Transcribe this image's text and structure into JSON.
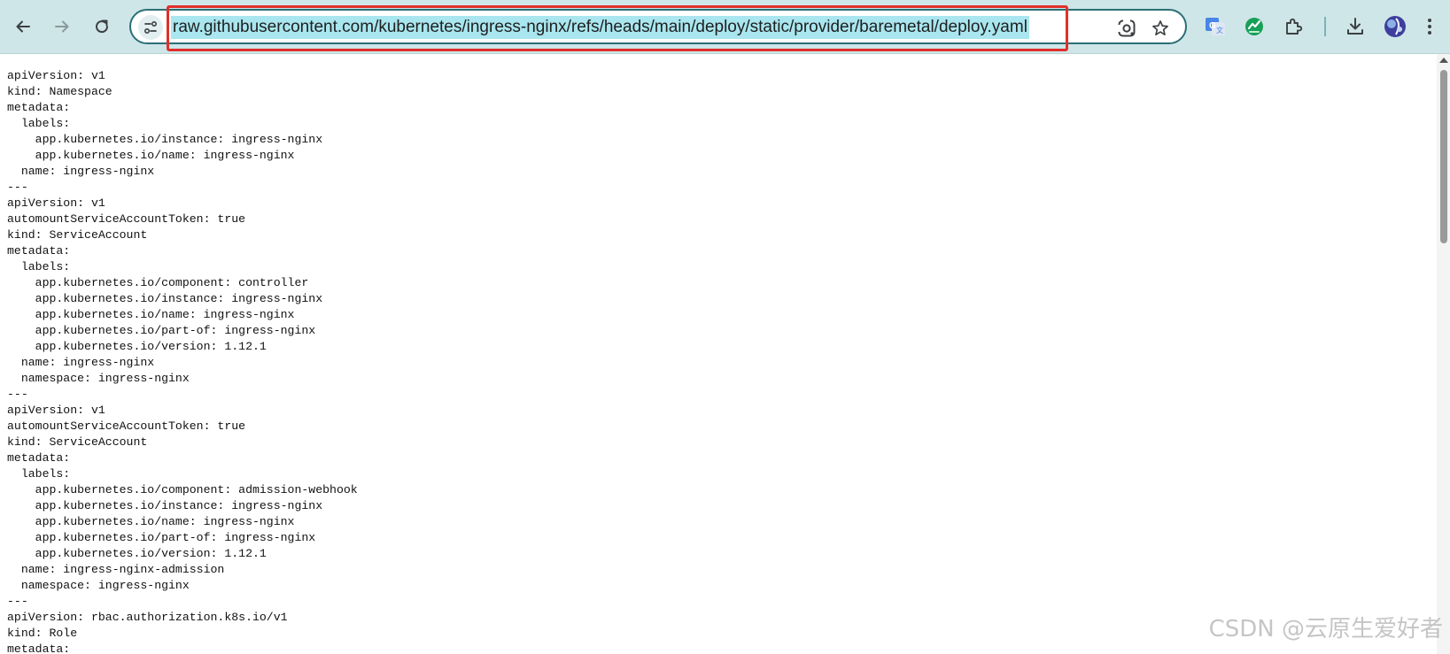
{
  "browser": {
    "url": "raw.githubusercontent.com/kubernetes/ingress-nginx/refs/heads/main/deploy/static/provider/baremetal/deploy.yaml",
    "icons": {
      "back": "back-arrow-icon",
      "forward": "forward-arrow-icon",
      "reload": "reload-icon",
      "site_info": "site-info-icon",
      "lens": "google-lens-icon",
      "bookmark": "star-icon",
      "translate": "google-translate-icon",
      "extension_green": "green-extension-icon",
      "extensions": "puzzle-icon",
      "downloads": "download-icon",
      "profile": "profile-avatar",
      "menu": "kebab-menu-icon"
    },
    "colors": {
      "toolbar": "#cfe6e8",
      "omnibox_border": "#2b6f76",
      "url_selection": "#a9e6ef",
      "highlight_box": "#e0302b"
    }
  },
  "document": {
    "content": "apiVersion: v1\nkind: Namespace\nmetadata:\n  labels:\n    app.kubernetes.io/instance: ingress-nginx\n    app.kubernetes.io/name: ingress-nginx\n  name: ingress-nginx\n---\napiVersion: v1\nautomountServiceAccountToken: true\nkind: ServiceAccount\nmetadata:\n  labels:\n    app.kubernetes.io/component: controller\n    app.kubernetes.io/instance: ingress-nginx\n    app.kubernetes.io/name: ingress-nginx\n    app.kubernetes.io/part-of: ingress-nginx\n    app.kubernetes.io/version: 1.12.1\n  name: ingress-nginx\n  namespace: ingress-nginx\n---\napiVersion: v1\nautomountServiceAccountToken: true\nkind: ServiceAccount\nmetadata:\n  labels:\n    app.kubernetes.io/component: admission-webhook\n    app.kubernetes.io/instance: ingress-nginx\n    app.kubernetes.io/name: ingress-nginx\n    app.kubernetes.io/part-of: ingress-nginx\n    app.kubernetes.io/version: 1.12.1\n  name: ingress-nginx-admission\n  namespace: ingress-nginx\n---\napiVersion: rbac.authorization.k8s.io/v1\nkind: Role\nmetadata:"
  },
  "watermark": "CSDN @云原生爱好者"
}
